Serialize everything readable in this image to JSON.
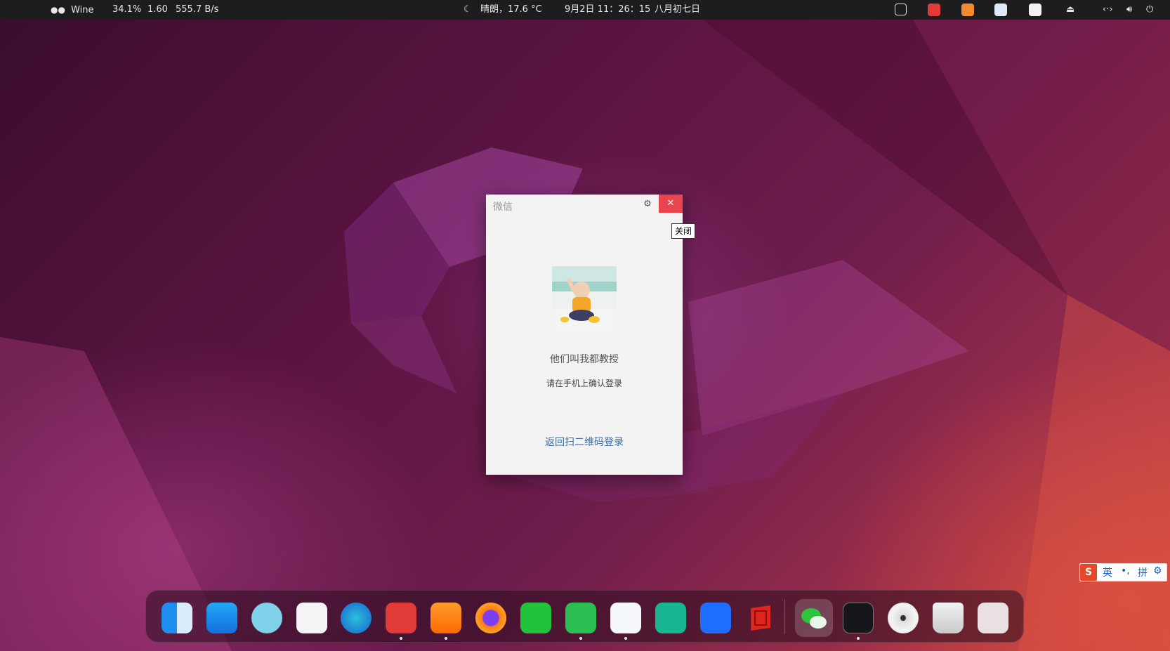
{
  "topbar": {
    "app_name": "Wine",
    "cpu": "34.1%",
    "load": "1.60",
    "net_speed": "555.7 B/s",
    "weather": "晴朗，17.6 °C",
    "datetime": "9月2日  11：26：15",
    "lunar": "八月初七日"
  },
  "wechat_window": {
    "title": "微信",
    "user_name": "他们叫我都教授",
    "hint": "请在手机上确认登录",
    "back_link": "返回扫二维码登录",
    "close_glyph": "✕",
    "settings_glyph": "⚙"
  },
  "tooltip": {
    "text": "关闭"
  },
  "ime": {
    "mode": "英",
    "punct": "•,",
    "pinyin": "拼",
    "settings_glyph": "⚙"
  },
  "dock": {
    "apps": [
      "Finder",
      "App Store",
      "Mail",
      "Settings",
      "Edge",
      "NetEase Music",
      "VLC",
      "Firefox",
      "WeChat",
      "Downloader",
      "Baidu Netdisk",
      "MindMaster",
      "Feishu",
      "WPS PDF",
      "WeChat (Wine)",
      "Terminal",
      "Disc",
      "Trash",
      "Launchpad"
    ]
  },
  "colors": {
    "close_red": "#e9454f",
    "link_blue": "#3a6ea5",
    "topbar_bg": "#1d1d1f"
  }
}
